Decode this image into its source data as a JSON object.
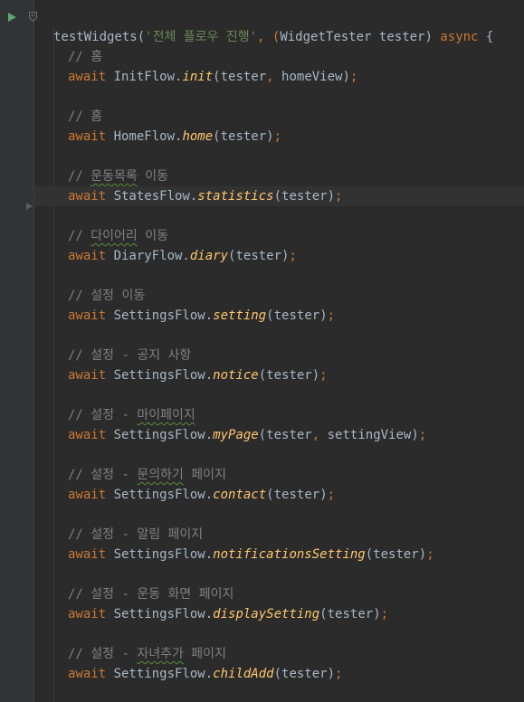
{
  "editor": {
    "header": {
      "fn": "testWidgets",
      "paren_open": "(",
      "string": "'전체 플로우 진행'",
      "sep": ", (",
      "type": "WidgetTester",
      "param": " tester) ",
      "async_kw": "async",
      "brace": " {"
    },
    "blocks": [
      {
        "comment_prefix": "// ",
        "comment_text": "홈",
        "comment_rest": "",
        "object": "InitFlow.",
        "method": "init",
        "args": "(tester",
        "extra_comma": ",",
        "extra_arg": " homeView",
        "close": ")",
        "semi": ";"
      },
      {
        "comment_prefix": "// ",
        "comment_text": "홈",
        "comment_rest": "",
        "object": "HomeFlow.",
        "method": "home",
        "args": "(tester",
        "extra_comma": "",
        "extra_arg": "",
        "close": ")",
        "semi": ";"
      },
      {
        "comment_prefix": "// ",
        "comment_text": "운동목록",
        "comment_rest": " 이동",
        "object": "StatesFlow.",
        "method": "statistics",
        "args": "(tester",
        "extra_comma": "",
        "extra_arg": "",
        "close": ")",
        "semi": ";"
      },
      {
        "comment_prefix": "// ",
        "comment_text": "다이어리",
        "comment_rest": " 이동",
        "object": "DiaryFlow.",
        "method": "diary",
        "args": "(tester",
        "extra_comma": "",
        "extra_arg": "",
        "close": ")",
        "semi": ";"
      },
      {
        "comment_prefix": "// ",
        "comment_text": "설정 이동",
        "comment_rest": "",
        "object": "SettingsFlow.",
        "method": "setting",
        "args": "(tester",
        "extra_comma": "",
        "extra_arg": "",
        "close": ")",
        "semi": ";"
      },
      {
        "comment_prefix": "// ",
        "comment_text": "설정 - 공지 사항",
        "comment_rest": "",
        "object": "SettingsFlow.",
        "method": "notice",
        "args": "(tester",
        "extra_comma": "",
        "extra_arg": "",
        "close": ")",
        "semi": ";"
      },
      {
        "comment_prefix": "// 설정 - ",
        "comment_text": "마이페이지",
        "comment_rest": "",
        "object": "SettingsFlow.",
        "method": "myPage",
        "args": "(tester",
        "extra_comma": ",",
        "extra_arg": " settingView",
        "close": ")",
        "semi": ";"
      },
      {
        "comment_prefix": "// 설정 - ",
        "comment_text": "문의하기",
        "comment_rest": " 페이지",
        "object": "SettingsFlow.",
        "method": "contact",
        "args": "(tester",
        "extra_comma": "",
        "extra_arg": "",
        "close": ")",
        "semi": ";"
      },
      {
        "comment_prefix": "// ",
        "comment_text": "설정 - 알림 페이지",
        "comment_rest": "",
        "object": "SettingsFlow.",
        "method": "notificationsSetting",
        "args": "(tester",
        "extra_comma": "",
        "extra_arg": "",
        "close": ")",
        "semi": ";"
      },
      {
        "comment_prefix": "// ",
        "comment_text": "설정 - 운동 화면 페이지",
        "comment_rest": "",
        "object": "SettingsFlow.",
        "method": "displaySetting",
        "args": "(tester",
        "extra_comma": "",
        "extra_arg": "",
        "close": ")",
        "semi": ";"
      },
      {
        "comment_prefix": "// 설정 - ",
        "comment_text": "자녀추가",
        "comment_rest": " 페이지",
        "object": "SettingsFlow.",
        "method": "childAdd",
        "args": "(tester",
        "extra_comma": "",
        "extra_arg": "",
        "close": ")",
        "semi": ";"
      }
    ],
    "await_kw": "await "
  },
  "gutter": {
    "run_icon": "run-triangle-icon",
    "fold_icon": "fold-marker-icon",
    "bookmark_icon": "bookmark-arrow-icon"
  },
  "colors": {
    "background": "#2b2b2b",
    "keyword": "#cc7832",
    "string": "#6a8759",
    "method": "#ffc66d",
    "comment": "#808080",
    "text": "#a9b7c6",
    "run": "#59a869"
  }
}
